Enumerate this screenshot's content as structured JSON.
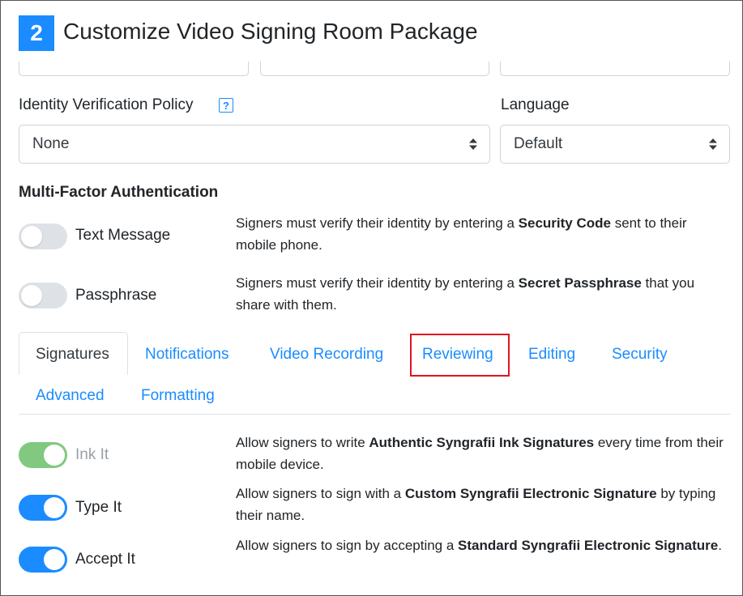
{
  "header": {
    "step_number": "2",
    "title": "Customize Video Signing Room Package"
  },
  "identity_policy": {
    "label": "Identity Verification Policy",
    "help_icon": "question-square-icon",
    "value": "None"
  },
  "language": {
    "label": "Language",
    "value": "Default"
  },
  "mfa": {
    "title": "Multi-Factor Authentication",
    "items": [
      {
        "label": "Text Message",
        "enabled": false,
        "desc_pre": "Signers must verify their identity by entering a ",
        "desc_bold": "Security Code",
        "desc_post": " sent to their mobile phone."
      },
      {
        "label": "Passphrase",
        "enabled": false,
        "desc_pre": "Signers must verify their identity by entering a ",
        "desc_bold": "Secret Passphrase",
        "desc_post": " that you share with them."
      }
    ]
  },
  "tabs": [
    {
      "label": "Signatures",
      "active": true
    },
    {
      "label": "Notifications",
      "active": false
    },
    {
      "label": "Video Recording",
      "active": false
    },
    {
      "label": "Reviewing",
      "active": false,
      "highlighted": true
    },
    {
      "label": "Editing",
      "active": false
    },
    {
      "label": "Security",
      "active": false
    },
    {
      "label": "Advanced",
      "active": false
    },
    {
      "label": "Formatting",
      "active": false
    }
  ],
  "signature_options": [
    {
      "label": "Ink It",
      "enabled": true,
      "disabled": true,
      "desc_pre": "Allow signers to write ",
      "desc_bold": "Authentic Syngrafii Ink Signatures",
      "desc_post": " every time from their mobile device."
    },
    {
      "label": "Type It",
      "enabled": true,
      "disabled": false,
      "desc_pre": "Allow signers to sign with a ",
      "desc_bold": "Custom Syngrafii Electronic Signature",
      "desc_post": " by typing their name."
    },
    {
      "label": "Accept It",
      "enabled": true,
      "disabled": false,
      "desc_pre": "Allow signers to sign by accepting a ",
      "desc_bold": "Standard Syngrafii Electronic Signature",
      "desc_post": "."
    }
  ],
  "colors": {
    "accent": "#1a8cff",
    "toggle_off": "#dee2e6",
    "toggle_on_disabled": "#80c97f",
    "highlight": "#e0141e"
  }
}
